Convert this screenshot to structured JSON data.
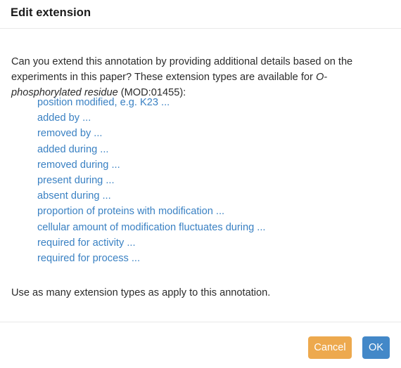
{
  "dialog": {
    "title": "Edit extension",
    "intro": {
      "before_term": "Can you extend this annotation by providing additional details based on the experiments in this paper? These extension types are available for ",
      "term": "O-phosphorylated residue",
      "after_term": " (MOD:01455):"
    },
    "extension_types": [
      {
        "label": "position modified, e.g. K23 ..."
      },
      {
        "label": "added by ..."
      },
      {
        "label": "removed by ..."
      },
      {
        "label": "added during ..."
      },
      {
        "label": "removed during ..."
      },
      {
        "label": "present during ..."
      },
      {
        "label": "absent during ..."
      },
      {
        "label": "proportion of proteins with modification ..."
      },
      {
        "label": "cellular amount of modification fluctuates during ..."
      },
      {
        "label": "required for activity ..."
      },
      {
        "label": "required for process ..."
      }
    ],
    "closing_text": "Use as many extension types as apply to this annotation.",
    "footer": {
      "cancel_label": "Cancel",
      "ok_label": "OK"
    },
    "colors": {
      "link": "#3a81c3",
      "cancel_button": "#eda94e",
      "ok_button": "#4388c8",
      "text": "#2b2b2b",
      "divider": "#e9e9e9",
      "background": "#ffffff"
    }
  }
}
